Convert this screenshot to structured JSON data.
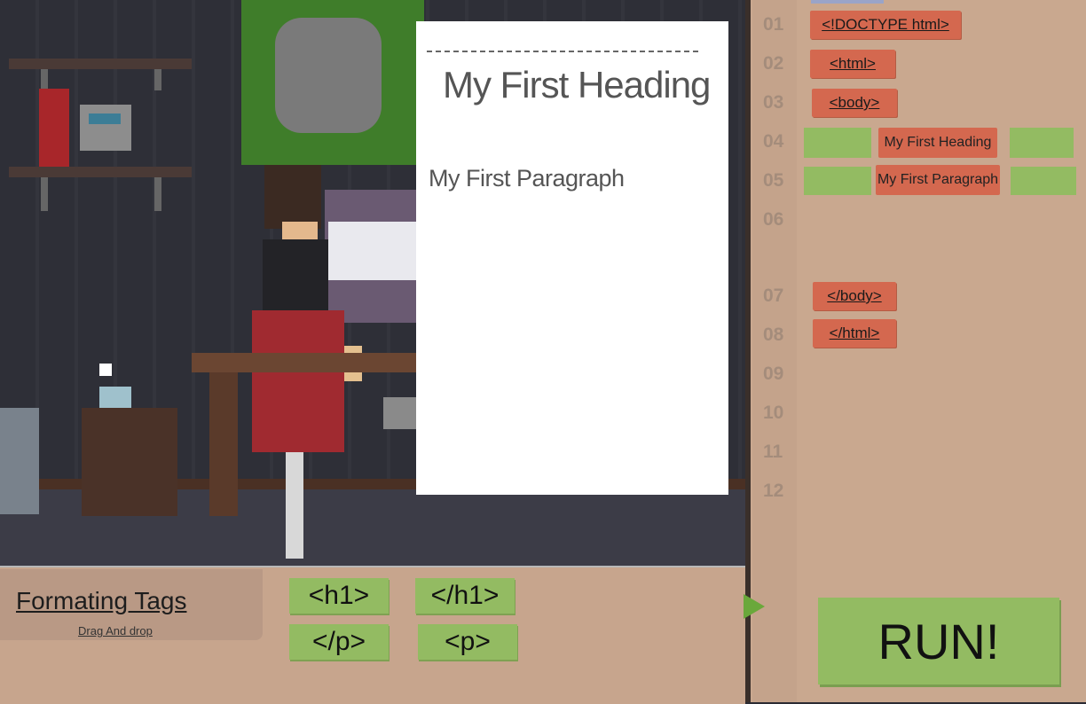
{
  "preview": {
    "heading": "My First Heading",
    "paragraph": "My First Paragraph"
  },
  "code": {
    "line_numbers": [
      "01",
      "02",
      "03",
      "04",
      "05",
      "06",
      "07",
      "08",
      "09",
      "10",
      "11",
      "12"
    ],
    "tags": {
      "doctype": "<!DOCTYPE html>",
      "html_open": "<html>",
      "body_open": "<body>",
      "body_close": "</body>",
      "html_close": "</html>"
    },
    "content": {
      "heading": "My First Heading",
      "paragraph": "My First Paragraph"
    }
  },
  "palette": {
    "title": "Formating Tags",
    "subtitle": "Drag And drop",
    "tags": [
      "<h1>",
      "</h1>",
      "</p>",
      "<p>"
    ]
  },
  "run_label": "RUN!"
}
